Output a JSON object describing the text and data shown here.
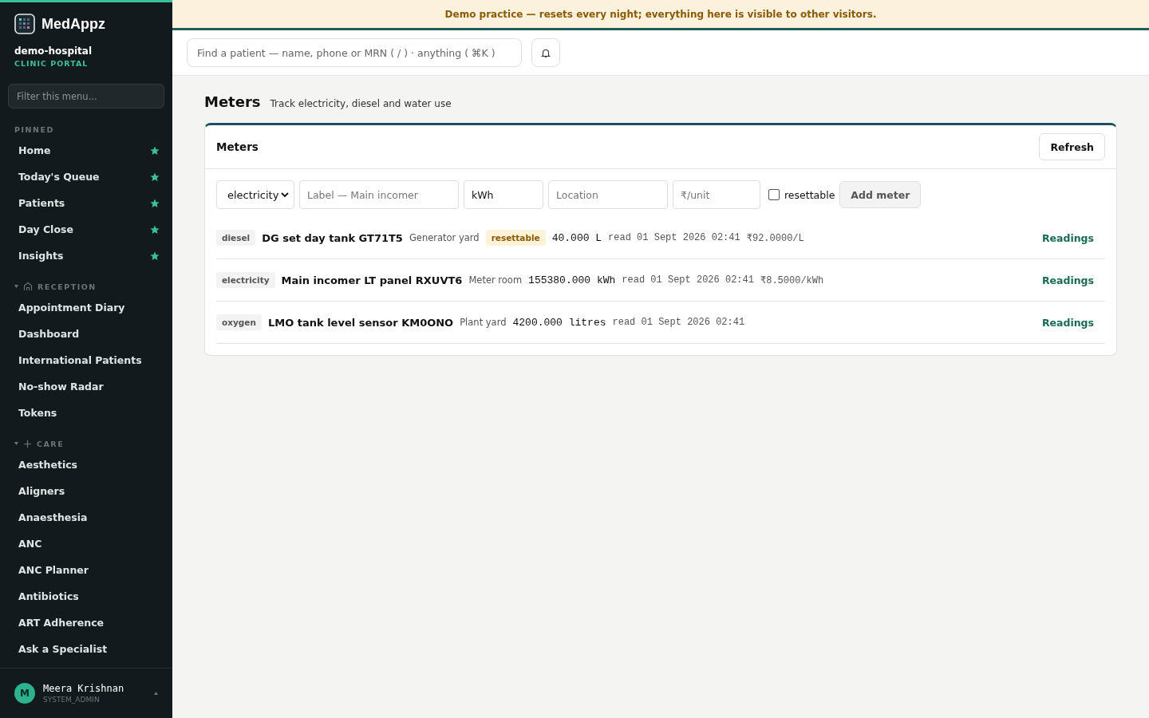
{
  "sidebar": {
    "brand": "MedAppz",
    "org": "demo-hospital",
    "portal": "CLINIC PORTAL",
    "filter_placeholder": "Filter this menu...",
    "sections": [
      {
        "title": "PINNED",
        "kind": "pinned",
        "items": [
          {
            "label": "Home",
            "pinned": true
          },
          {
            "label": "Today's Queue",
            "pinned": true
          },
          {
            "label": "Patients",
            "pinned": true
          },
          {
            "label": "Day Close",
            "pinned": true
          },
          {
            "label": "Insights",
            "pinned": true
          }
        ]
      },
      {
        "title": "RECEPTION",
        "kind": "reception",
        "expanded": true,
        "items": [
          {
            "label": "Appointment Diary",
            "pinned": false
          },
          {
            "label": "Dashboard",
            "pinned": false
          },
          {
            "label": "International Patients",
            "pinned": false
          },
          {
            "label": "No-show Radar",
            "pinned": false
          },
          {
            "label": "Tokens",
            "pinned": false
          }
        ]
      },
      {
        "title": "CARE",
        "kind": "care",
        "expanded": true,
        "items": [
          {
            "label": "Aesthetics",
            "pinned": false
          },
          {
            "label": "Aligners",
            "pinned": false
          },
          {
            "label": "Anaesthesia",
            "pinned": false
          },
          {
            "label": "ANC",
            "pinned": false
          },
          {
            "label": "ANC Planner",
            "pinned": false
          },
          {
            "label": "Antibiotics",
            "pinned": false
          },
          {
            "label": "ART Adherence",
            "pinned": false
          },
          {
            "label": "Ask a Specialist",
            "pinned": false
          }
        ]
      }
    ],
    "user": {
      "initial": "M",
      "name": "Meera Krishnan",
      "role": "SYSTEM_ADMIN"
    }
  },
  "banner": "Demo practice — resets every night; everything here is visible to other visitors.",
  "search": {
    "placeholder": "Find a patient — name, phone or MRN ( / ) · anything ( ⌘K )"
  },
  "page": {
    "title": "Meters",
    "subtitle": "Track electricity, diesel and water use"
  },
  "card": {
    "title": "Meters",
    "refresh": "Refresh",
    "form": {
      "type": "electricity",
      "label_placeholder": "Label — Main incomer",
      "unit": "kWh",
      "location_placeholder": "Location",
      "rate_placeholder": "₹/unit",
      "resettable_label": "resettable",
      "resettable": false,
      "submit": "Add meter"
    },
    "meters": [
      {
        "type": "diesel",
        "name": "DG set day tank GT71T5",
        "location": "Generator yard",
        "resettable": true,
        "resettable_label": "resettable",
        "reading": "40.000 L",
        "read_at": "read 01 Sept 2026 02:41",
        "rate": "₹92.0000/L",
        "action": "Readings"
      },
      {
        "type": "electricity",
        "name": "Main incomer LT panel RXUVT6",
        "location": "Meter room",
        "resettable": false,
        "reading": "155380.000 kWh",
        "read_at": "read 01 Sept 2026 02:41",
        "rate": "₹8.5000/kWh",
        "action": "Readings"
      },
      {
        "type": "oxygen",
        "name": "LMO tank level sensor KM0ONO",
        "location": "Plant yard",
        "resettable": false,
        "reading": "4200.000 litres",
        "read_at": "read 01 Sept 2026 02:41",
        "action": "Readings"
      }
    ]
  }
}
